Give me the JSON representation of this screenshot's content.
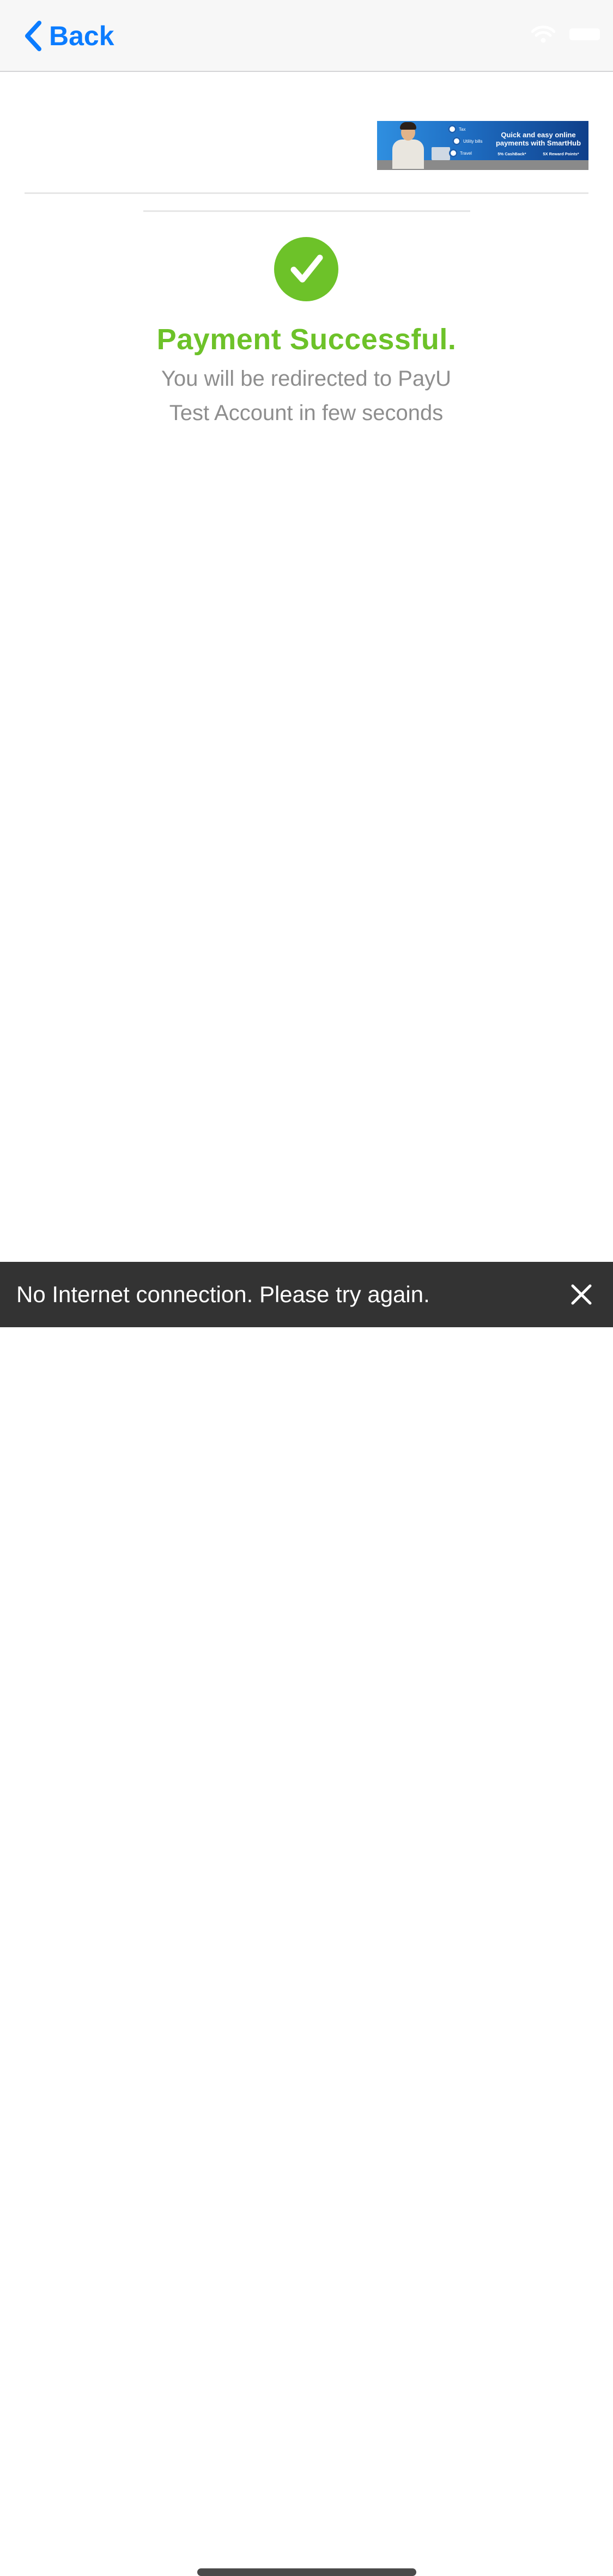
{
  "navbar": {
    "back_label": "Back",
    "back_icon": "chevron-left-icon",
    "status_icons": [
      "wifi-icon",
      "battery-icon"
    ]
  },
  "banner": {
    "items": [
      "Tax",
      "Utility bills",
      "Travel"
    ],
    "headline": "Quick and easy online payments with SmartHub",
    "offers": [
      "5% CashBack*",
      "5X Reward Points*"
    ]
  },
  "payment": {
    "icon": "checkmark-icon",
    "title": "Payment Successful.",
    "message": "You will be redirected to PayU Test Account in few seconds"
  },
  "snackbar": {
    "message": "No Internet connection. Please try again.",
    "close_icon": "close-icon"
  },
  "colors": {
    "accent_blue": "#0b7cff",
    "success_green": "#6dc229",
    "muted_text": "#8e8e8e",
    "snackbar_bg": "#333333"
  }
}
